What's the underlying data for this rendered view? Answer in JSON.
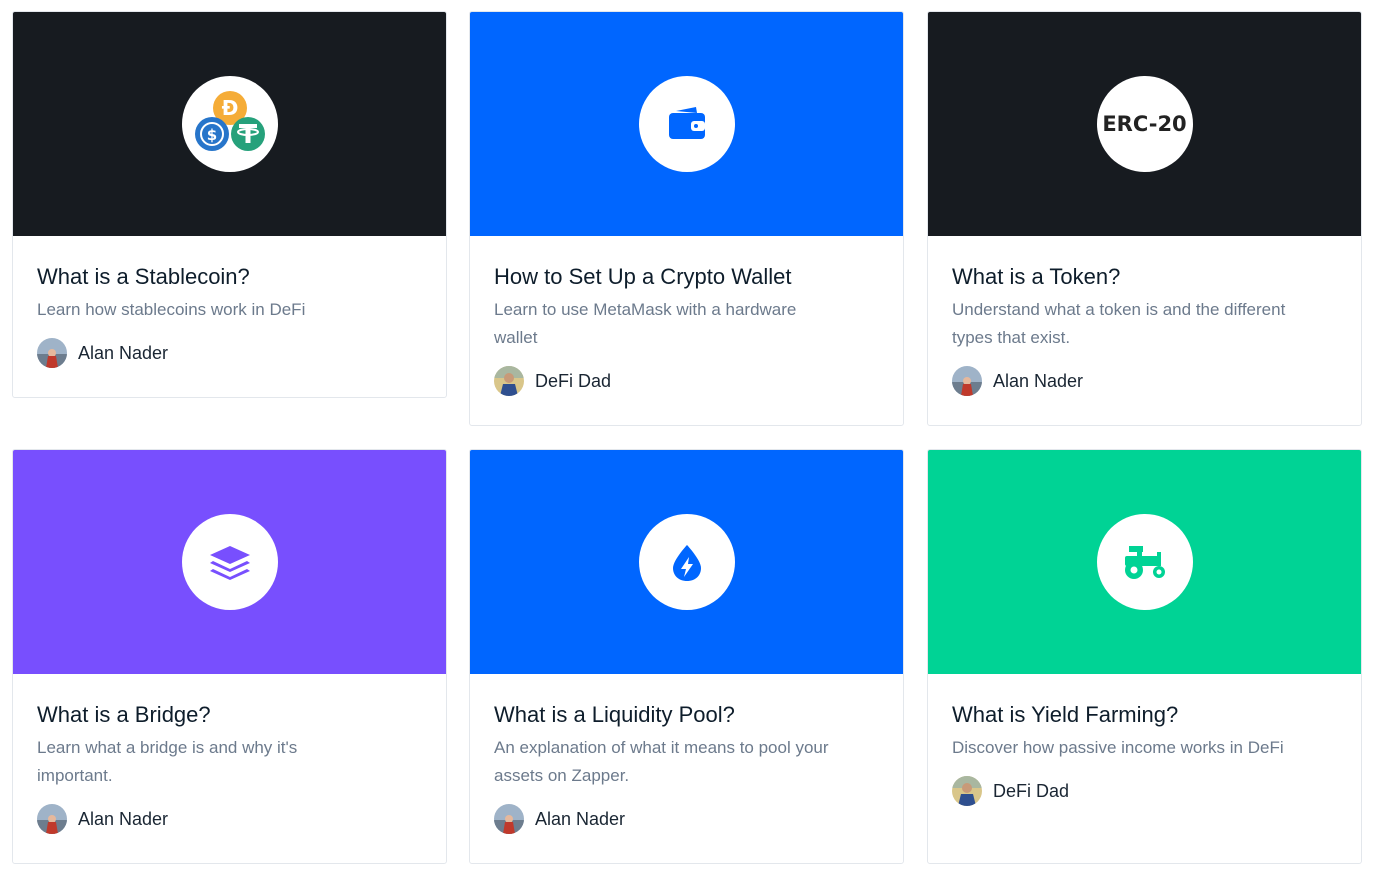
{
  "cards": [
    {
      "title": "What is a Stablecoin?",
      "description": "Learn how stablecoins work in DeFi",
      "author": "Alan Nader",
      "banner_color": "#171b20",
      "icon": "stablecoins-icon"
    },
    {
      "title": "How to Set Up a Crypto Wallet",
      "description": "Learn to use MetaMask with a hardware wallet",
      "author": "DeFi Dad",
      "banner_color": "#0066ff",
      "icon": "wallet-icon"
    },
    {
      "title": "What is a Token?",
      "description": "Understand what a token is and the different types that exist.",
      "author": "Alan Nader",
      "banner_color": "#171b20",
      "icon": "erc20-icon",
      "icon_text": "ERC-20"
    },
    {
      "title": "What is a Bridge?",
      "description": "Learn what a bridge is and why it's important.",
      "author": "Alan Nader",
      "banner_color": "#784ffe",
      "icon": "layers-icon"
    },
    {
      "title": "What is a Liquidity Pool?",
      "description": "An explanation of what it means to pool your assets on Zapper.",
      "author": "Alan Nader",
      "banner_color": "#0066ff",
      "icon": "droplet-bolt-icon"
    },
    {
      "title": "What is Yield Farming?",
      "description": "Discover how passive income works in DeFi",
      "author": "DeFi Dad",
      "banner_color": "#00d395",
      "icon": "tractor-icon"
    }
  ]
}
